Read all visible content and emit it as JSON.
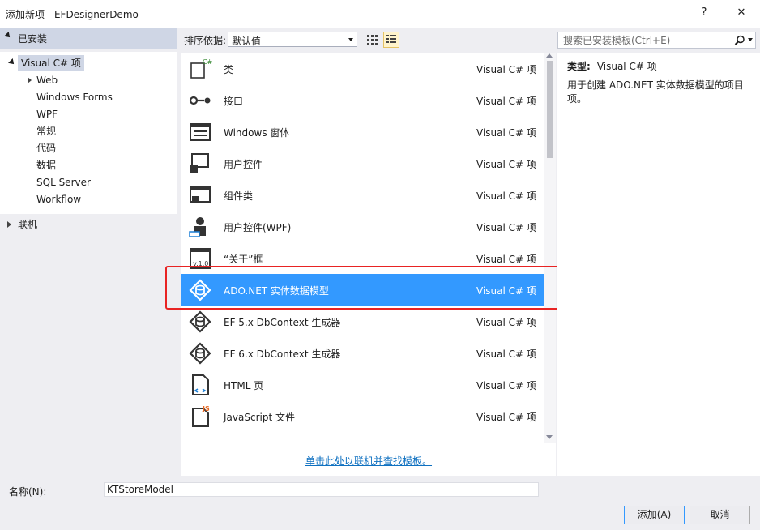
{
  "window": {
    "title": "添加新项 - EFDesignerDemo",
    "help_label": "?",
    "close_label": "✕"
  },
  "left_panel": {
    "header": "已安装",
    "tree": [
      {
        "label": "Visual C# 项",
        "selected": true
      },
      {
        "label": "Web"
      },
      {
        "label": "Windows Forms"
      },
      {
        "label": "WPF"
      },
      {
        "label": "常规"
      },
      {
        "label": "代码"
      },
      {
        "label": "数据"
      },
      {
        "label": "SQL Server"
      },
      {
        "label": "Workflow"
      }
    ],
    "online": "联机"
  },
  "toolbar": {
    "sort_label": "排序依据:",
    "sort_value": "默认值",
    "search_placeholder": "搜索已安装模板(Ctrl+E)"
  },
  "templates": [
    {
      "name": "类",
      "category": "Visual C# 项",
      "icon": "class-icon"
    },
    {
      "name": "接口",
      "category": "Visual C# 项",
      "icon": "interface-icon"
    },
    {
      "name": "Windows 窗体",
      "category": "Visual C# 项",
      "icon": "windows-form-icon"
    },
    {
      "name": "用户控件",
      "category": "Visual C# 项",
      "icon": "user-control-icon"
    },
    {
      "name": "组件类",
      "category": "Visual C# 项",
      "icon": "component-class-icon"
    },
    {
      "name": "用户控件(WPF)",
      "category": "Visual C# 项",
      "icon": "wpf-user-control-icon"
    },
    {
      "name": "“关于”框",
      "category": "Visual C# 项",
      "icon": "about-box-icon"
    },
    {
      "name": "ADO.NET 实体数据模型",
      "category": "Visual C# 项",
      "icon": "entity-model-icon",
      "selected": true
    },
    {
      "name": "EF 5.x DbContext 生成器",
      "category": "Visual C# 项",
      "icon": "dbcontext-generator-icon"
    },
    {
      "name": "EF 6.x DbContext 生成器",
      "category": "Visual C# 项",
      "icon": "dbcontext-generator-icon"
    },
    {
      "name": "HTML 页",
      "category": "Visual C# 项",
      "icon": "html-page-icon"
    },
    {
      "name": "JavaScript 文件",
      "category": "Visual C# 项",
      "icon": "javascript-file-icon"
    }
  ],
  "online_link": "单击此处以联机并查找模板。",
  "description": {
    "type_label": "类型:",
    "type_value": "Visual C# 项",
    "text": "用于创建 ADO.NET 实体数据模型的项目项。"
  },
  "footer": {
    "name_label": "名称(N):",
    "name_value": "KTStoreModel",
    "add_label": "添加(A)",
    "cancel_label": "取消"
  },
  "colors": {
    "selection": "#3399ff",
    "highlight_border": "#e82323",
    "link": "#0e70c0"
  }
}
